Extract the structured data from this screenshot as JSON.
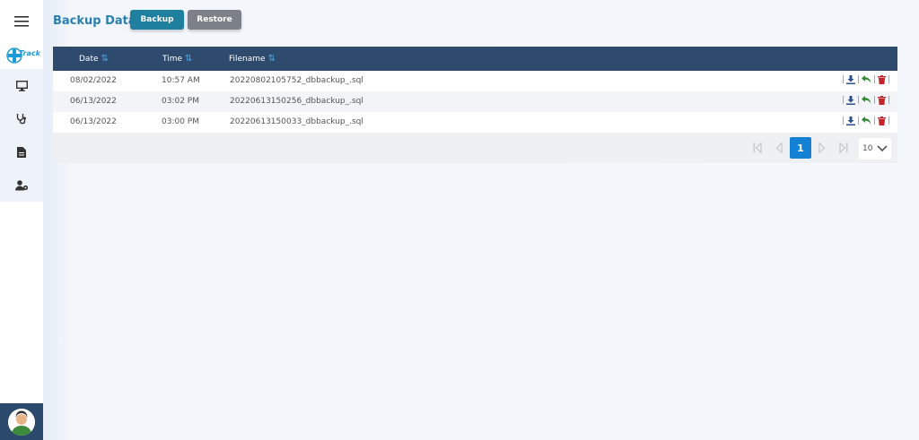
{
  "sidebar": {
    "logo_text": "Track",
    "items": [
      {
        "icon": "monitor-icon"
      },
      {
        "icon": "stethoscope-icon"
      },
      {
        "icon": "document-icon"
      },
      {
        "icon": "user-settings-icon"
      }
    ],
    "avatar": "avatar"
  },
  "page": {
    "title": "Backup Data",
    "backup_label": "Backup",
    "restore_label": "Restore"
  },
  "table": {
    "columns": [
      "Date",
      "Time",
      "Filename"
    ],
    "rows": [
      {
        "date": "08/02/2022",
        "time": "10:57 AM",
        "filename": "20220802105752_dbbackup_.sql"
      },
      {
        "date": "06/13/2022",
        "time": "03:02 PM",
        "filename": "20220613150256_dbbackup_.sql"
      },
      {
        "date": "06/13/2022",
        "time": "03:00 PM",
        "filename": "20220613150033_dbbackup_.sql"
      }
    ]
  },
  "pagination": {
    "current_page": "1",
    "page_size": "10"
  },
  "colors": {
    "header_bg": "#2e4a6c",
    "accent": "#1481d4",
    "download": "#2d4f8a",
    "restore": "#2e8b2e",
    "delete": "#c0262b"
  }
}
